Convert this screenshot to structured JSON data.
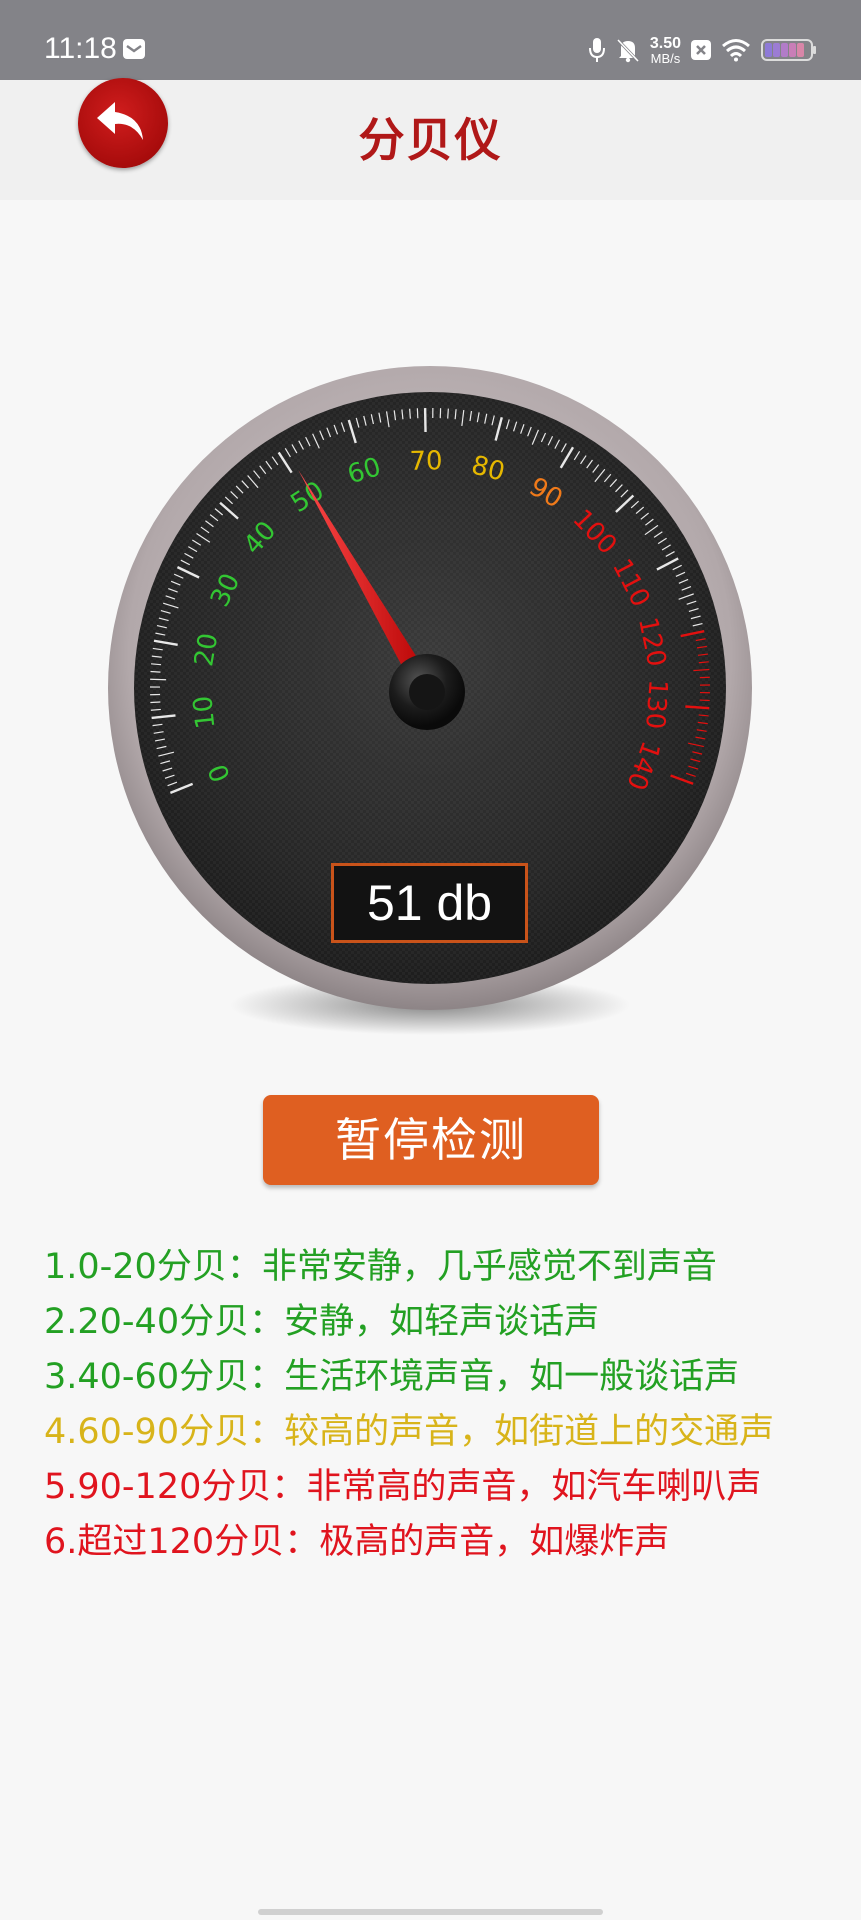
{
  "status_bar": {
    "time": "11:18",
    "net_speed_value": "3.50",
    "net_speed_unit": "MB/s",
    "icons": [
      "message-icon",
      "microphone-icon",
      "bell-muted-icon",
      "close-box-icon",
      "wifi-icon",
      "battery-icon"
    ]
  },
  "header": {
    "title": "分贝仪",
    "back_icon": "back-arrow-icon"
  },
  "gauge": {
    "value": 51,
    "min": 0,
    "max": 140,
    "major_ticks": [
      0,
      10,
      20,
      30,
      40,
      50,
      60,
      70,
      80,
      90,
      100,
      110,
      120,
      130,
      140
    ],
    "readout": "51 db",
    "colors": {
      "green": "#33c633",
      "yellow": "#e6b800",
      "orange": "#f07a1a",
      "red": "#e3100f"
    }
  },
  "button": {
    "label": "暂停检测"
  },
  "legend": [
    {
      "text": "1.0-20分贝：非常安静，几乎感觉不到声音",
      "color": "#23a023"
    },
    {
      "text": "2.20-40分贝：安静，如轻声谈话声",
      "color": "#23a023"
    },
    {
      "text": "3.40-60分贝：生活环境声音，如一般谈话声",
      "color": "#23a023"
    },
    {
      "text": "4.60-90分贝：较高的声音，如街道上的交通声",
      "color": "#d8b41a"
    },
    {
      "text": "5.90-120分贝：非常高的声音，如汽车喇叭声",
      "color": "#e0141e"
    },
    {
      "text": "6.超过120分贝：极高的声音，如爆炸声",
      "color": "#e0141e"
    }
  ]
}
